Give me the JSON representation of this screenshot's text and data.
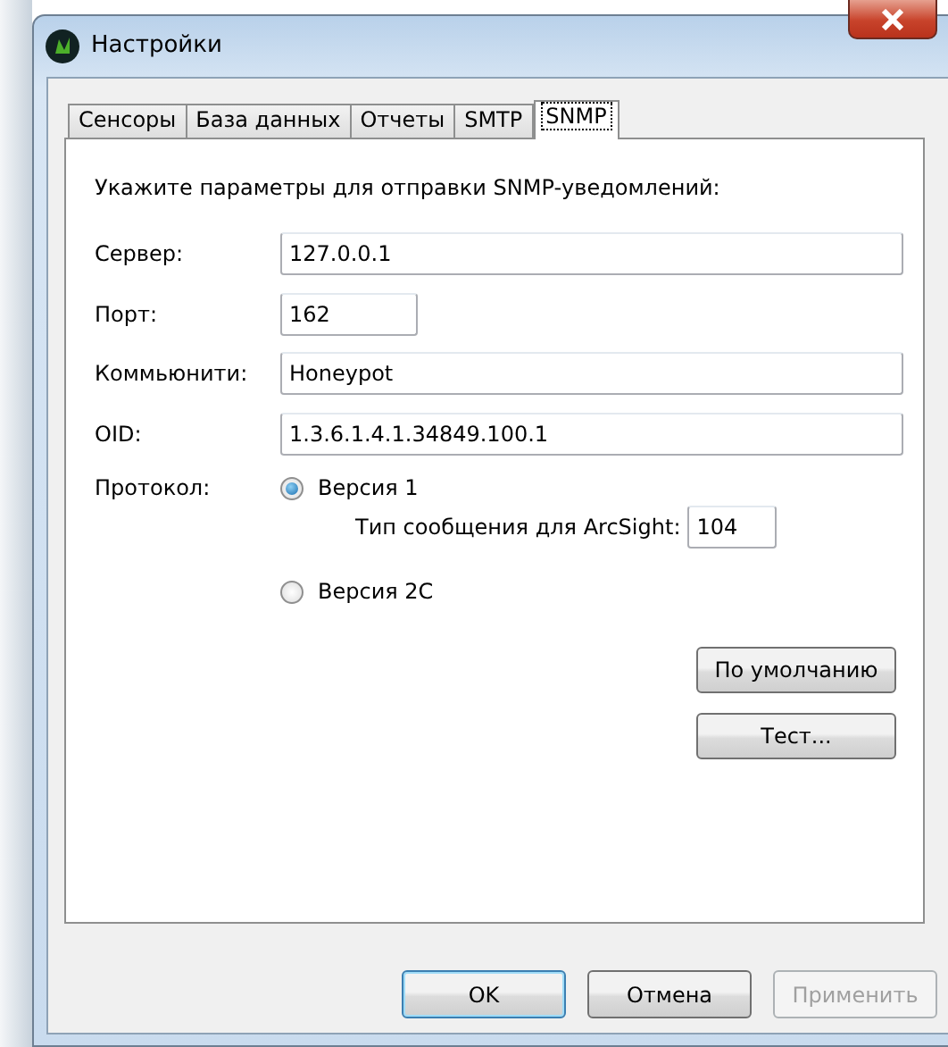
{
  "window": {
    "title": "Настройки"
  },
  "tabs": [
    {
      "label": "Сенсоры",
      "selected": false
    },
    {
      "label": "База данных",
      "selected": false
    },
    {
      "label": "Отчеты",
      "selected": false
    },
    {
      "label": "SMTP",
      "selected": false
    },
    {
      "label": "SNMP",
      "selected": true
    }
  ],
  "intro": "Укажите параметры для отправки SNMP-уведомлений:",
  "fields": [
    {
      "label": "Сервер:",
      "value": "127.0.0.1",
      "kind": "wide"
    },
    {
      "label": "Порт:",
      "value": "162",
      "kind": "short"
    },
    {
      "label": "Коммьюнити:",
      "value": "Honeypot",
      "kind": "wide"
    },
    {
      "label": "OID:",
      "value": "1.3.6.1.4.1.34849.100.1",
      "kind": "wide"
    }
  ],
  "protocol": {
    "label": "Протокол:",
    "options": [
      {
        "label": "Версия 1",
        "selected": true,
        "sub_label": "Тип сообщения для ArcSight:",
        "sub_value": "104"
      },
      {
        "label": "Версия 2C",
        "selected": false
      }
    ]
  },
  "side_buttons": [
    "По умолчанию",
    "Тест..."
  ],
  "buttons": [
    {
      "label": "OK",
      "default": true,
      "disabled": false
    },
    {
      "label": "Отмена",
      "default": false,
      "disabled": false
    },
    {
      "label": "Применить",
      "default": false,
      "disabled": true
    }
  ]
}
